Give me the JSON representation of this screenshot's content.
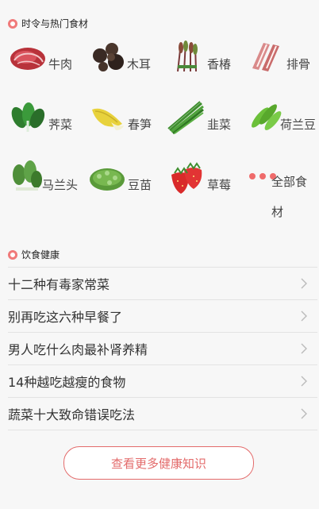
{
  "section_ingredients": {
    "title": "时令与热门食材"
  },
  "ingredients": [
    {
      "name": "牛肉",
      "icon": "beef-icon"
    },
    {
      "name": "木耳",
      "icon": "wood-ear-icon"
    },
    {
      "name": "香椿",
      "icon": "toon-sprout-icon"
    },
    {
      "name": "排骨",
      "icon": "ribs-icon"
    },
    {
      "name": "荠菜",
      "icon": "shepherds-purse-icon"
    },
    {
      "name": "春笋",
      "icon": "bamboo-shoot-icon"
    },
    {
      "name": "韭菜",
      "icon": "chives-icon"
    },
    {
      "name": "荷兰豆",
      "icon": "snow-pea-icon"
    },
    {
      "name": "马兰头",
      "icon": "malan-greens-icon"
    },
    {
      "name": "豆苗",
      "icon": "pea-sprouts-icon"
    },
    {
      "name": "草莓",
      "icon": "strawberry-icon"
    },
    {
      "name": "全部食材",
      "icon": "more-dots-icon"
    }
  ],
  "section_health": {
    "title": "饮食健康"
  },
  "articles": [
    "十二种有毒家常菜",
    "别再吃这六种早餐了",
    "男人吃什么肉最补肾养精",
    "14种越吃越瘦的食物",
    "蔬菜十大致命错误吃法"
  ],
  "more_button": "查看更多健康知识",
  "colors": {
    "accent": "#e36b6b",
    "background": "#f7f7f7",
    "divider": "#e3e3e3"
  }
}
